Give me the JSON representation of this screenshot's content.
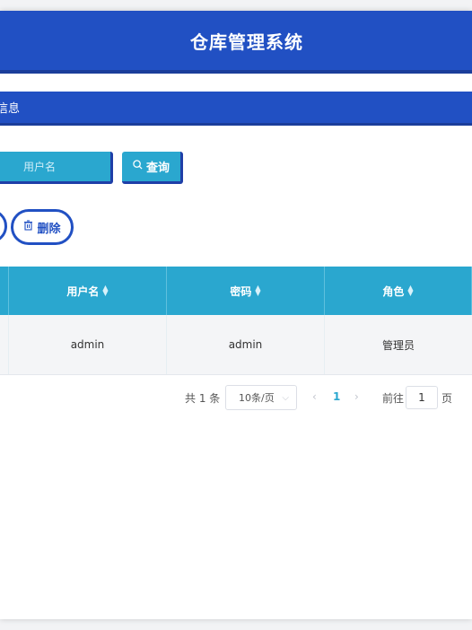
{
  "header": {
    "title": "仓库管理系统"
  },
  "subbar": {
    "title": "信息"
  },
  "search": {
    "placeholder": "用户名",
    "query_label": "查询"
  },
  "toolbar": {
    "delete_label": "删除"
  },
  "table": {
    "columns": [
      "用户名",
      "密码",
      "角色"
    ],
    "rows": [
      [
        "admin",
        "admin",
        "管理员"
      ]
    ]
  },
  "pagination": {
    "total_text": "共 1 条",
    "page_size": "10条/页",
    "current_page": "1",
    "goto_label": "前往",
    "goto_value": "1",
    "page_unit": "页"
  },
  "colors": {
    "primary": "#2150c3",
    "accent": "#2aa7cf"
  }
}
